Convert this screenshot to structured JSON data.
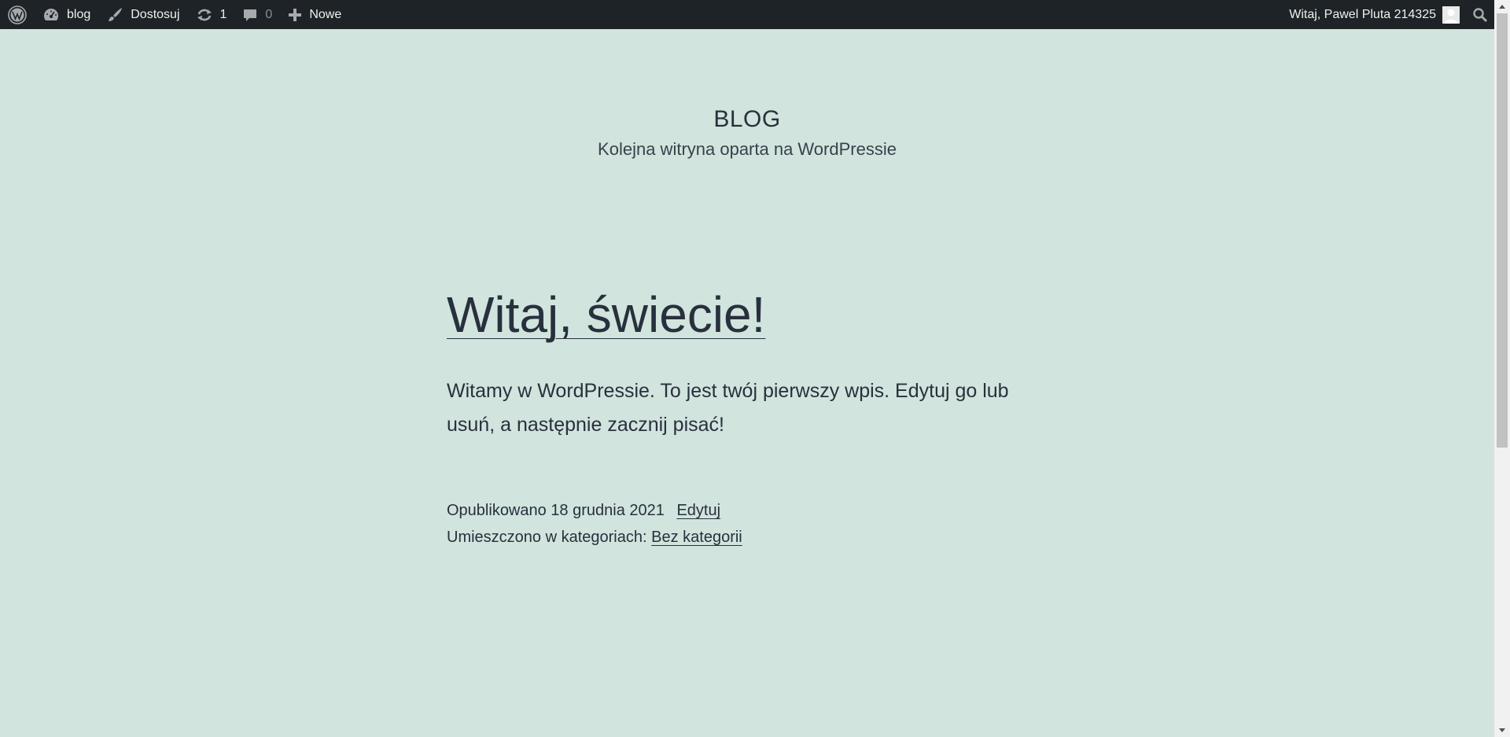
{
  "adminbar": {
    "site_name": "blog",
    "customize_label": "Dostosuj",
    "updates_count": "1",
    "comments_count": "0",
    "new_label": "Nowe",
    "greeting": "Witaj, Pawel Pluta 214325",
    "icons": {
      "wp_logo": "wordpress-logo-icon",
      "site": "dashboard-icon",
      "customize": "brush-icon",
      "updates": "refresh-icon",
      "comments": "comment-icon",
      "new": "plus-icon",
      "search": "search-icon"
    }
  },
  "site": {
    "title": "BLOG",
    "description": "Kolejna witryna oparta na WordPressie"
  },
  "post": {
    "title": "Witaj, świecie!",
    "content": "Witamy w WordPressie. To jest twój pierwszy wpis. Edytuj go lub usuń, a następnie zacznij pisać!",
    "published_prefix": "Opublikowano",
    "published_date": "18 grudnia 2021",
    "edit_label": "Edytuj",
    "categories_prefix": "Umieszczono w kategoriach:",
    "category": "Bez kategorii"
  },
  "colors": {
    "background": "#d1e4dd",
    "adminbar": "#1d2327",
    "text": "#28303d"
  }
}
